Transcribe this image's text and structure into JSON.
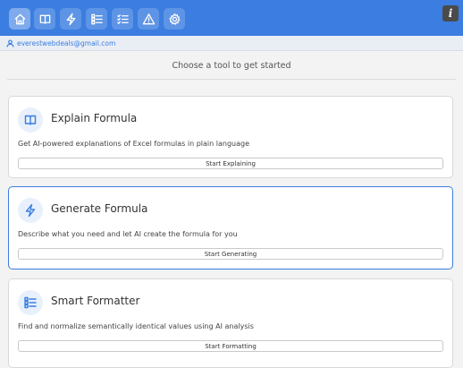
{
  "toolbar": {
    "buttons": [
      {
        "icon": "home-icon"
      },
      {
        "icon": "book-icon"
      },
      {
        "icon": "lightning-icon"
      },
      {
        "icon": "list-icon"
      },
      {
        "icon": "checklist-icon"
      },
      {
        "icon": "warning-icon"
      },
      {
        "icon": "gear-icon"
      }
    ],
    "info_label": "i",
    "accent": "#3b7de0"
  },
  "user": {
    "email": "everestwebdeals@gmail.com"
  },
  "subtitle": "Choose a tool to get started",
  "cards": [
    {
      "icon": "book-icon",
      "title": "Explain Formula",
      "description": "Get AI-powered explanations of Excel formulas in plain language",
      "button": "Start Explaining"
    },
    {
      "icon": "lightning-icon",
      "title": "Generate Formula",
      "description": "Describe what you need and let AI create the formula for you",
      "button": "Start Generating"
    },
    {
      "icon": "list-icon",
      "title": "Smart Formatter",
      "description": "Find and normalize semantically identical values using AI analysis",
      "button": "Start Formatting"
    }
  ]
}
